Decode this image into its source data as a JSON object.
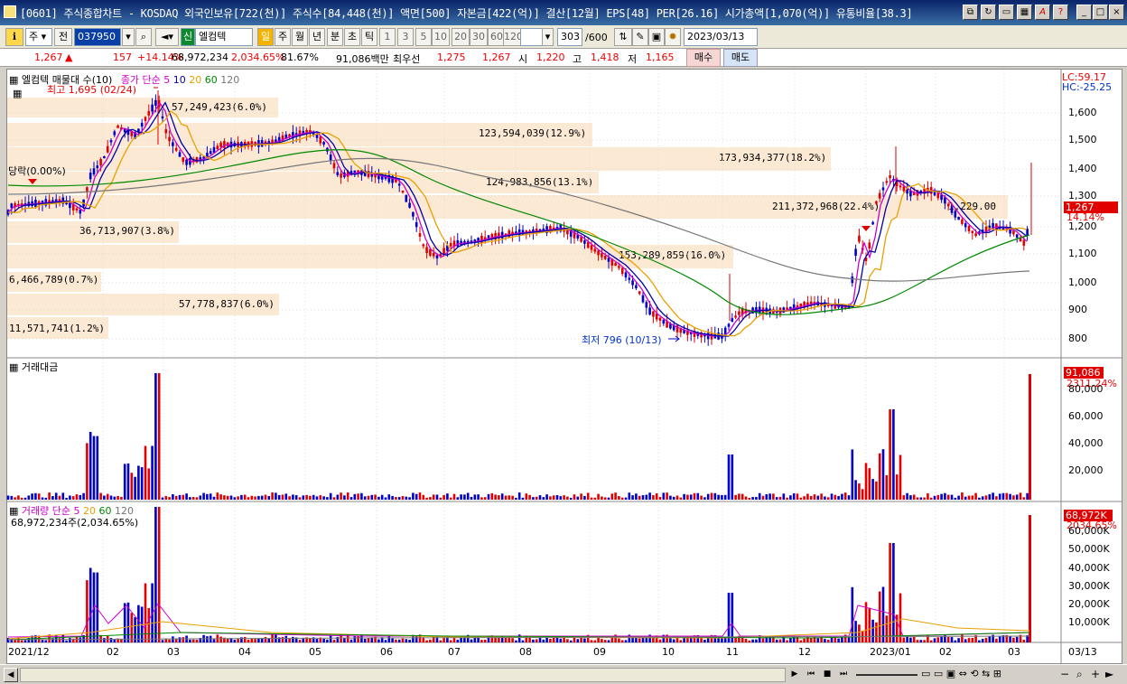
{
  "window": {
    "title": "[0601] 주식종합차트 - KOSDAQ 외국인보유[722(천)] 주식수[84,448(천)] 액면[500] 자본금[422(억)] 결산[12월] EPS[48] PER[26.16] 시가총액[1,070(억)] 유통비율[38.3]",
    "minimize": "_",
    "maximize": "□",
    "close": "×"
  },
  "toolbar": {
    "market": "주",
    "prev": "전",
    "code": "037950",
    "name_prefix": "신",
    "stock_name": "엘컴텍",
    "periods": [
      "일",
      "주",
      "월",
      "년",
      "분",
      "초",
      "틱"
    ],
    "active_period": "일",
    "numbers": [
      "1",
      "3",
      "5",
      "10",
      "20",
      "30",
      "60",
      "120"
    ],
    "count": "303",
    "total": "/600",
    "date": "2023/03/13"
  },
  "quote": {
    "price": "1,267",
    "arrow": "▲",
    "change": "157",
    "change_pct": "+14.14%",
    "volume": "68,972,234",
    "volume_pct": "2,034.65%",
    "ratio": "81.67%",
    "amount": "91,086백만",
    "best_label": "최우선",
    "best_ask": "1,275",
    "best_bid": "1,267",
    "open_label": "시",
    "open": "1,220",
    "high_label": "고",
    "high": "1,418",
    "low_label": "저",
    "low": "1,165",
    "buy": "매수",
    "sell": "매도"
  },
  "chart": {
    "price_panel": {
      "legend_name": "엘컴텍 매물대 수(10)",
      "legend_ma": "종가 단순",
      "ma_periods": [
        "5",
        "10",
        "20",
        "60",
        "120"
      ],
      "lc": "LC:59.17",
      "hc": "HC:-25.25",
      "high_note": "최고 1,695 (02/24)",
      "low_note": "최저 796 (10/13)",
      "left_note": "당락(0.00%)",
      "current_price": "1,267",
      "current_pct": "14.14%",
      "overlap_label": "211,372,968(22.4%)",
      "overlap_label2": "1,229.00"
    },
    "volume_profile": [
      {
        "label": "57,249,423(6.0%)"
      },
      {
        "label": "123,594,039(12.9%)"
      },
      {
        "label": "173,934,377(18.2%)"
      },
      {
        "label": "124,983,856(13.1%)"
      },
      {
        "label": "211,372,968(22.4%)"
      },
      {
        "label": "36,713,907(3.8%)"
      },
      {
        "label": "153,289,859(16.0%)"
      },
      {
        "label": "6,466,789(0.7%)"
      },
      {
        "label": "57,778,837(6.0%)"
      },
      {
        "label": "11,571,741(1.2%)"
      }
    ],
    "price_ticks": [
      "1,600",
      "1,500",
      "1,400",
      "1,300",
      "1,200",
      "1,100",
      "1,000",
      "900",
      "800"
    ],
    "amount_panel": {
      "legend": "거래대금",
      "value": "91,086",
      "pct": "2311.24%",
      "ticks": [
        "80,000",
        "60,000",
        "40,000",
        "20,000"
      ]
    },
    "volume_panel": {
      "legend": "거래량 단순",
      "ma_periods": [
        "5",
        "20",
        "60",
        "120"
      ],
      "sub_legend": "68,972,234주(2,034.65%)",
      "value": "68,972K",
      "pct": "2034.65%",
      "ticks": [
        "60,000K",
        "50,000K",
        "40,000K",
        "30,000K",
        "20,000K",
        "10,000K"
      ]
    },
    "x_ticks": [
      "2021/12",
      "02",
      "03",
      "04",
      "05",
      "06",
      "07",
      "08",
      "09",
      "10",
      "11",
      "12",
      "2023/01",
      "02",
      "03"
    ],
    "x_right": "03/13",
    "colors": {
      "up": "#e00000",
      "down": "#0000cc",
      "ma5": "#cc00cc",
      "ma10": "#0000aa",
      "ma20": "#e8a000",
      "ma60": "#008800",
      "ma120": "#777777",
      "band": "#fbe9d4"
    }
  }
}
